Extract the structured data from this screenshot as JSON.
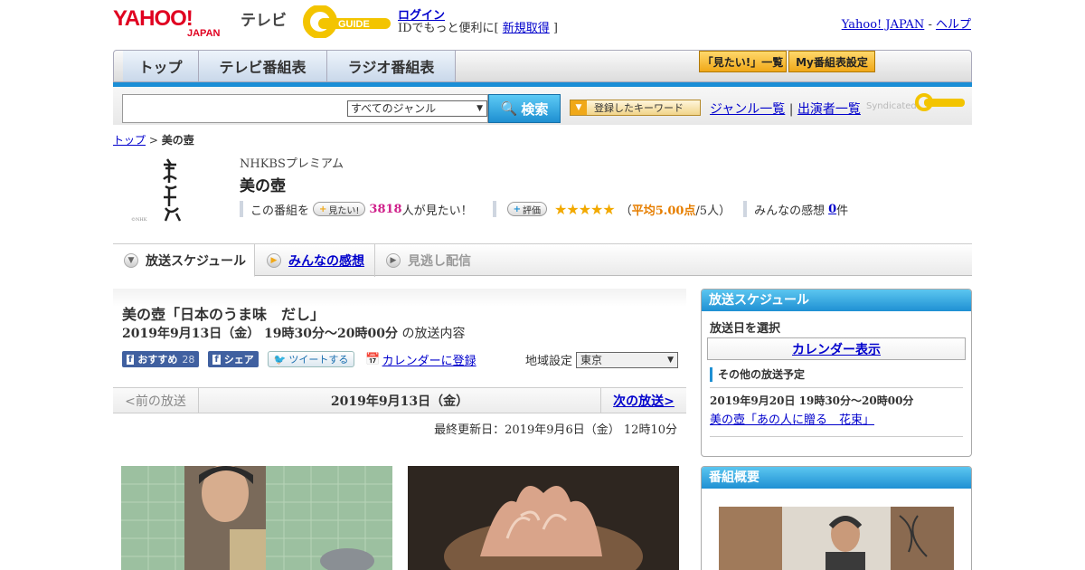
{
  "header": {
    "yahoo_logo": "YAHOO! JAPAN",
    "tv_label": "テレビ",
    "gguide_logo": "GUIDE",
    "login_link": "ログイン",
    "login_sub_prefix": "IDでもっと便利に[ ",
    "signup_link": "新規取得",
    "login_sub_suffix": " ]",
    "yahoo_japan_link": "Yahoo! JAPAN",
    "separator": " - ",
    "help_link": "ヘルプ"
  },
  "nav": {
    "tabs": [
      "トップ",
      "テレビ番組表",
      "ラジオ番組表"
    ],
    "mitai_list": "「見たい!」一覧",
    "my_schedule": "My番組表設定"
  },
  "search": {
    "genre_select": "すべてのジャンル",
    "search_button": "検索",
    "keyword_button": "登録したキーワード",
    "genre_list": "ジャンル一覧",
    "divider": "|",
    "cast_list": "出演者一覧",
    "syndicated": "Syndicated"
  },
  "breadcrumb": {
    "top": "トップ",
    "sep": " > ",
    "current": "美の壺"
  },
  "program": {
    "channel": "NHKBSプレミアム",
    "title": "美の壺",
    "mitai_prefix": "この番組を",
    "mitai_button": "見たい!",
    "mitai_count": "3818",
    "mitai_suffix": "人が見たい！",
    "rate_button": "評価",
    "stars": "★★★★★",
    "avg_open": "（",
    "avg_label": "平均5.00点",
    "avg_close": "/5人）",
    "impressions_label": "みんなの感想",
    "impressions_count": "0",
    "impressions_unit": "件"
  },
  "tabs": {
    "schedule": "放送スケジュール",
    "impressions": "みんなの感想",
    "missed": "見逃し配信"
  },
  "episode": {
    "title": "美の壺「日本のうま味　だし」",
    "date": "2019年9月13日（金） 19時30分～20時00分",
    "date_suffix": " の放送内容",
    "fb_recommend": "おすすめ",
    "fb_count": "28",
    "fb_share": "シェア",
    "tweet": "ツイートする",
    "calendar": "カレンダーに登録",
    "region_label": "地域設定",
    "region_value": "東京",
    "prev": "<前の放送",
    "current_date": "2019年9月13日（金）",
    "next": "次の放送>",
    "updated": "最終更新日：2019年9月6日（金） 12時10分"
  },
  "sidebar": {
    "schedule_header": "放送スケジュール",
    "select_date": "放送日を選択",
    "calendar_button": "カレンダー表示",
    "other_label": "その他の放送予定",
    "other_date": "2019年9月20日 19時30分～20時00分",
    "other_link": "美の壺「あの人に贈る　花束」",
    "overview_header": "番組概要"
  },
  "colors": {
    "accent_blue": "#1f90d3",
    "mitai_pink": "#d0218b",
    "star_gold": "#f2a900",
    "link_blue": "#0000cc"
  }
}
